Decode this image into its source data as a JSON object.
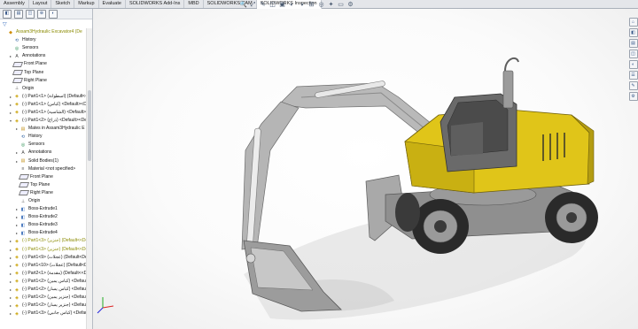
{
  "tabs": [
    {
      "label": "Assembly"
    },
    {
      "label": "Layout"
    },
    {
      "label": "Sketch"
    },
    {
      "label": "Markup"
    },
    {
      "label": "Evaluate"
    },
    {
      "label": "SOLIDWORKS Add-Ins"
    },
    {
      "label": "MBD"
    },
    {
      "label": "SOLIDWORKS CAM"
    },
    {
      "label": "SOLIDWORKS Inspection",
      "active": true
    }
  ],
  "feature_tree": {
    "nodes": [
      {
        "label": "Assam3Hydraulic Excavator4 (De",
        "icon": "assembly",
        "depth": 0,
        "warn": true
      },
      {
        "label": "History",
        "icon": "history",
        "depth": 1
      },
      {
        "label": "Sensors",
        "icon": "sensor",
        "depth": 1
      },
      {
        "label": "Annotations",
        "icon": "annotation",
        "depth": 1,
        "expand": "▸"
      },
      {
        "label": "Front Plane",
        "icon": "plane",
        "depth": 1
      },
      {
        "label": "Top Plane",
        "icon": "plane",
        "depth": 1
      },
      {
        "label": "Right Plane",
        "icon": "plane",
        "depth": 1
      },
      {
        "label": "Origin",
        "icon": "origin",
        "depth": 1
      },
      {
        "label": "(-) Part1<1> (اسطوانة) (Default<<Def",
        "icon": "part",
        "depth": 1,
        "expand": "▸"
      },
      {
        "label": "(-) Part1<1> (كباس) <Default><Defa",
        "icon": "part",
        "depth": 1,
        "expand": "▸"
      },
      {
        "label": "(-) Part1<1> (الشاسيه) <Default><De",
        "icon": "part",
        "depth": 1,
        "expand": "▸"
      },
      {
        "label": "(-) Part1<2> (ذراع) <Default><Defau",
        "icon": "part",
        "depth": 1,
        "expand": "▾"
      },
      {
        "label": "Mates in Assam3Hydraulic E",
        "icon": "folder",
        "depth": 2,
        "expand": "▸"
      },
      {
        "label": "History",
        "icon": "history",
        "depth": 2
      },
      {
        "label": "Sensors",
        "icon": "sensor",
        "depth": 2
      },
      {
        "label": "Annotations",
        "icon": "annotation",
        "depth": 2,
        "expand": "▸"
      },
      {
        "label": "Solid Bodies(1)",
        "icon": "folder",
        "depth": 2,
        "expand": "▸"
      },
      {
        "label": "Material <not specified>",
        "icon": "material",
        "depth": 2
      },
      {
        "label": "Front Plane",
        "icon": "plane",
        "depth": 2
      },
      {
        "label": "Top Plane",
        "icon": "plane",
        "depth": 2
      },
      {
        "label": "Right Plane",
        "icon": "plane",
        "depth": 2
      },
      {
        "label": "Origin",
        "icon": "origin",
        "depth": 2
      },
      {
        "label": "Boss-Extrude1",
        "icon": "feature",
        "depth": 2,
        "expand": "▸"
      },
      {
        "label": "Boss-Extrude2",
        "icon": "feature",
        "depth": 2,
        "expand": "▸"
      },
      {
        "label": "Boss-Extrude3",
        "icon": "feature",
        "depth": 2,
        "expand": "▸"
      },
      {
        "label": "Boss-Extrude4",
        "icon": "feature",
        "depth": 2,
        "expand": "▸"
      },
      {
        "label": "(-) Part1<3> (جنزير) (Default<<Def",
        "icon": "part",
        "depth": 1,
        "expand": "▸",
        "warn": true
      },
      {
        "label": "(-) Part1<3> (جنزير) (Default<<Def",
        "icon": "part",
        "depth": 1,
        "expand": "▸",
        "warn": true
      },
      {
        "label": "(-) Part1<9> (عجلات) (Default<Defa",
        "icon": "part",
        "depth": 1,
        "expand": "▸"
      },
      {
        "label": "(-) Part1<10> (عجلات) (Default<Defa",
        "icon": "part",
        "depth": 1,
        "expand": "▸"
      },
      {
        "label": "(-) Part2<1> (مقدمة) (Default<<Defa",
        "icon": "part",
        "depth": 1,
        "expand": "▸"
      },
      {
        "label": "(-) Part1<2> (كباس يمين) <Default><C",
        "icon": "part",
        "depth": 1,
        "expand": "▸"
      },
      {
        "label": "(-) Part1<2> (كباس يسار) <Default><C",
        "icon": "part",
        "depth": 1,
        "expand": "▸"
      },
      {
        "label": "(-) Part1<2> (جنزير يمين) <Default><C",
        "icon": "part",
        "depth": 1,
        "expand": "▸"
      },
      {
        "label": "(-) Part1<2> (جنزير يسار) <Default><C",
        "icon": "part",
        "depth": 1,
        "expand": "▸"
      },
      {
        "label": "(-) Part1<3> (كباس جانبي) <Default><C",
        "icon": "part",
        "depth": 1,
        "expand": "▸"
      }
    ]
  },
  "icons": {
    "assembly": "◆",
    "history": "⟲",
    "sensor": "◎",
    "annotation": "A",
    "plane": "▱",
    "origin": "⊥",
    "part": "◈",
    "folder": "▤",
    "material": "≡",
    "feature": "◧"
  },
  "headsup_icons": [
    "🔍",
    "⤢",
    "✎",
    "◫",
    "▣",
    "◐",
    "◑",
    "⊞",
    "◎",
    "✦",
    "▭",
    "⚙"
  ],
  "taskpane_icons": [
    "⌂",
    "◧",
    "▤",
    "◫",
    "◐",
    "☰",
    "✎",
    "⚙"
  ],
  "colors": {
    "body": "#e0c519",
    "body_shade": "#a58f0a",
    "arm": "#b5b5b5",
    "tire": "#2a2a2a",
    "rim": "#9a9a9a",
    "cab_glass": "#5a5a5a",
    "shadow": "#d2d2d2"
  }
}
